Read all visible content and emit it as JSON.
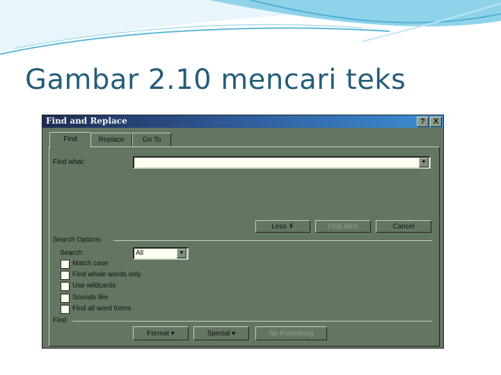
{
  "slide": {
    "title": "Gambar 2.10 mencari teks"
  },
  "dialog": {
    "title": "Find and Replace",
    "help_icon": "?",
    "close_icon": "X",
    "tabs": [
      {
        "label": "Find",
        "active": true
      },
      {
        "label": "Replace"
      },
      {
        "label": "Go To"
      }
    ],
    "find_what_label": "Find what:",
    "find_what_value": "",
    "buttons": {
      "less": "Less ⇞",
      "find_next": "Find Next",
      "cancel": "Cancel",
      "format": "Format ▾",
      "special": "Special ▾",
      "no_formatting": "No Formatting"
    },
    "search_options_label": "Search Options",
    "search_label": "Search:",
    "search_value": "All",
    "options": [
      {
        "label": "Match case",
        "checked": false
      },
      {
        "label": "Find whole words only",
        "checked": false
      },
      {
        "label": "Use wildcards",
        "checked": false
      },
      {
        "label": "Sounds like",
        "checked": false
      },
      {
        "label": "Find all word forms",
        "checked": false
      }
    ],
    "find_group_label": "Find"
  },
  "colors": {
    "dialog_bg": "#637661",
    "title_text": "#245d7a",
    "accent": "#3d8fd4"
  }
}
